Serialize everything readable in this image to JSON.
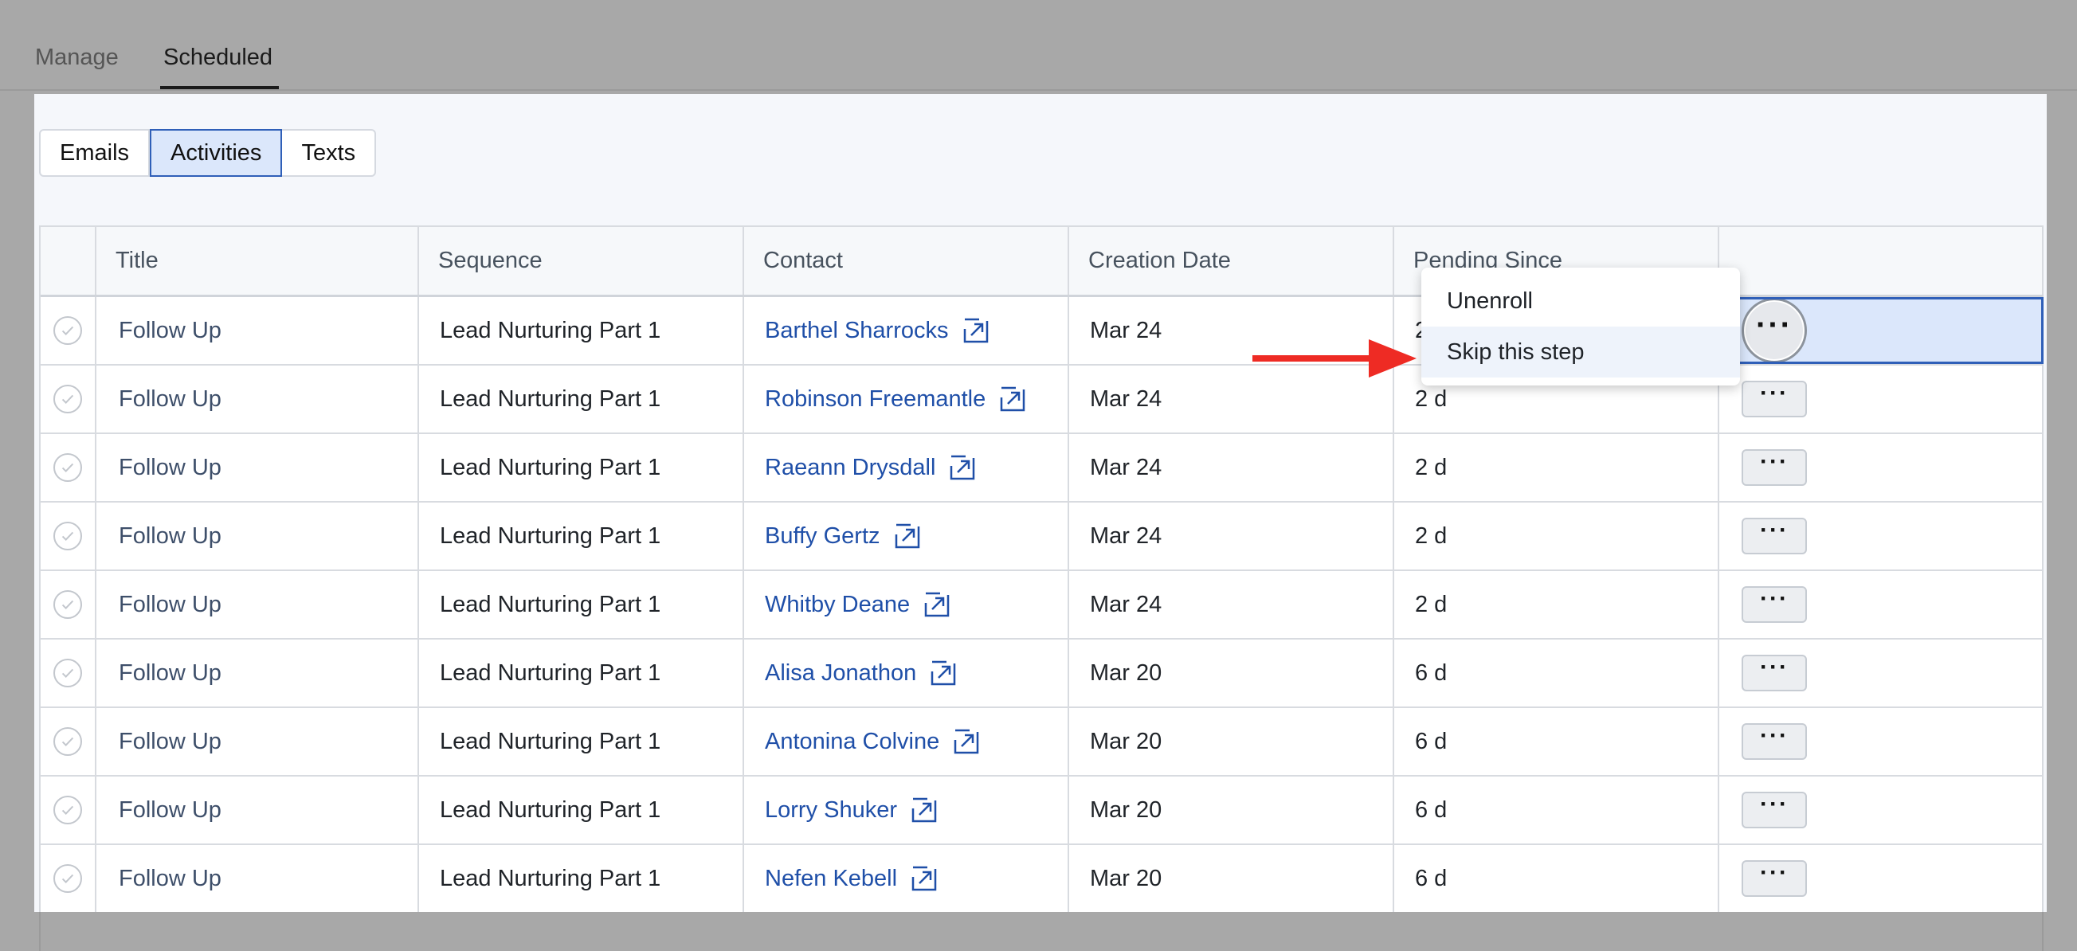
{
  "top_tabs": [
    "Manage",
    "Scheduled"
  ],
  "sub_tabs": [
    "Emails",
    "Activities",
    "Texts"
  ],
  "columns": [
    "Title",
    "Sequence",
    "Contact",
    "Creation Date",
    "Pending Since",
    ""
  ],
  "rows": [
    {
      "title": "Follow Up",
      "sequence": "Lead Nurturing Part 1",
      "contact": "Barthel Sharrocks",
      "created": "Mar 24",
      "pending": "2 d"
    },
    {
      "title": "Follow Up",
      "sequence": "Lead Nurturing Part 1",
      "contact": "Robinson Freemantle",
      "created": "Mar 24",
      "pending": "2 d"
    },
    {
      "title": "Follow Up",
      "sequence": "Lead Nurturing Part 1",
      "contact": "Raeann Drysdall",
      "created": "Mar 24",
      "pending": "2 d"
    },
    {
      "title": "Follow Up",
      "sequence": "Lead Nurturing Part 1",
      "contact": "Buffy Gertz",
      "created": "Mar 24",
      "pending": "2 d"
    },
    {
      "title": "Follow Up",
      "sequence": "Lead Nurturing Part 1",
      "contact": "Whitby Deane",
      "created": "Mar 24",
      "pending": "2 d"
    },
    {
      "title": "Follow Up",
      "sequence": "Lead Nurturing Part 1",
      "contact": "Alisa Jonathon",
      "created": "Mar 20",
      "pending": "6 d"
    },
    {
      "title": "Follow Up",
      "sequence": "Lead Nurturing Part 1",
      "contact": "Antonina Colvine",
      "created": "Mar 20",
      "pending": "6 d"
    },
    {
      "title": "Follow Up",
      "sequence": "Lead Nurturing Part 1",
      "contact": "Lorry Shuker",
      "created": "Mar 20",
      "pending": "6 d"
    },
    {
      "title": "Follow Up",
      "sequence": "Lead Nurturing Part 1",
      "contact": "Nefen Kebell",
      "created": "Mar 20",
      "pending": "6 d"
    }
  ],
  "more_label": "···",
  "menu": [
    "Unenroll",
    "Skip this step"
  ],
  "colors": {
    "accent": "#2f5fb8",
    "link": "#1f4fa8",
    "annotation_arrow": "#ee2b24"
  }
}
